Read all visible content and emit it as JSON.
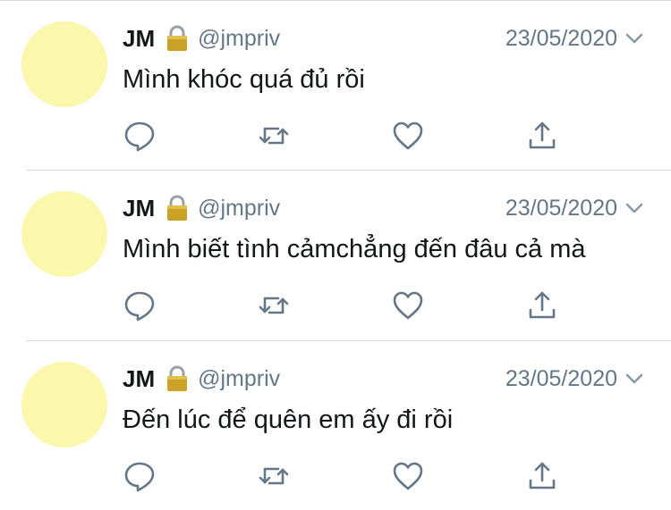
{
  "tweets": [
    {
      "author_name": "JM",
      "handle": "@jmpriv",
      "date": "23/05/2020",
      "text": "Mình khóc quá đủ rồi"
    },
    {
      "author_name": "JM",
      "handle": "@jmpriv",
      "date": "23/05/2020",
      "text": "Mình biết tình cảmchẳng đến đâu cả mà"
    },
    {
      "author_name": "JM",
      "handle": "@jmpriv",
      "date": "23/05/2020",
      "text": "Đến lúc để quên em ấy đi rồi"
    }
  ],
  "icons": {
    "lock": "lock-icon",
    "chevron": "chevron-down-icon",
    "reply": "reply-icon",
    "retweet": "retweet-icon",
    "like": "heart-icon",
    "share": "share-icon"
  },
  "colors": {
    "avatar": "#fbf8ad",
    "icon": "#657786",
    "secondary_text": "#657786",
    "divider": "#d6d9dc"
  }
}
